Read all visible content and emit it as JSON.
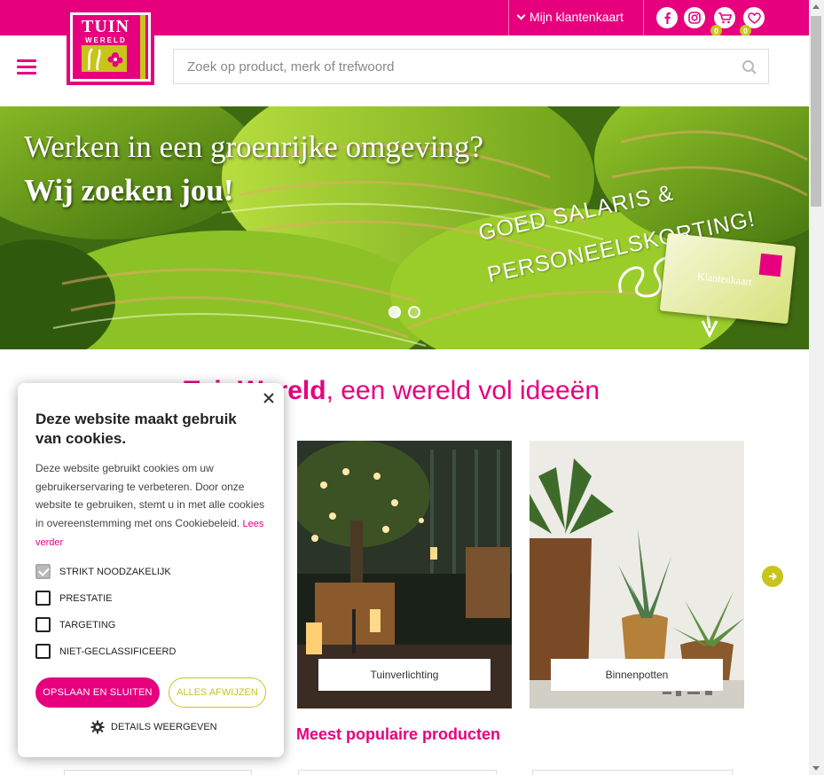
{
  "colors": {
    "brand": "#e6007e",
    "accent": "#c8c41c"
  },
  "topbar": {
    "klantenkaart_label": "Mijn klantenkaart",
    "cart_count": "0",
    "wishlist_count": "0",
    "icons": [
      "facebook-icon",
      "instagram-icon",
      "cart-icon",
      "heart-icon"
    ]
  },
  "header": {
    "logo_top": "TUIN",
    "logo_bottom": "WERELD",
    "search_placeholder": "Zoek op product, merk of trefwoord"
  },
  "hero": {
    "headline": "Werken in een groenrijke omgeving?",
    "subheadline": "Wij zoeken jou!",
    "slogan_line1": "GOED SALARIS &",
    "slogan_line2": "PERSONEELSKORTING!",
    "card_label": "Klantenkaart",
    "slides": 2,
    "active_slide": 1
  },
  "main": {
    "title_brand": "TuinWereld",
    "title_rest": ", een wereld vol ideeën",
    "categories": [
      {
        "label": "Tuinverlichting"
      },
      {
        "label": "Binnenpotten"
      }
    ],
    "popular_title": "Meest populaire producten"
  },
  "cookie": {
    "title": "Deze website maakt gebruik van cookies.",
    "body": "Deze website gebruikt cookies om uw gebruikerservaring te verbeteren. Door onze website te gebruiken, stemt u in met alle cookies in overeenstemming met ons Cookiebeleid.",
    "read_more": "Lees verder",
    "options": [
      {
        "label": "STRIKT NOODZAKELIJK",
        "checked": true
      },
      {
        "label": "PRESTATIE",
        "checked": false
      },
      {
        "label": "TARGETING",
        "checked": false
      },
      {
        "label": "NIET-GECLASSIFICEERD",
        "checked": false
      }
    ],
    "save_label": "OPSLAAN EN SLUITEN",
    "reject_label": "ALLES AFWIJZEN",
    "details_label": "DETAILS WEERGEVEN"
  }
}
